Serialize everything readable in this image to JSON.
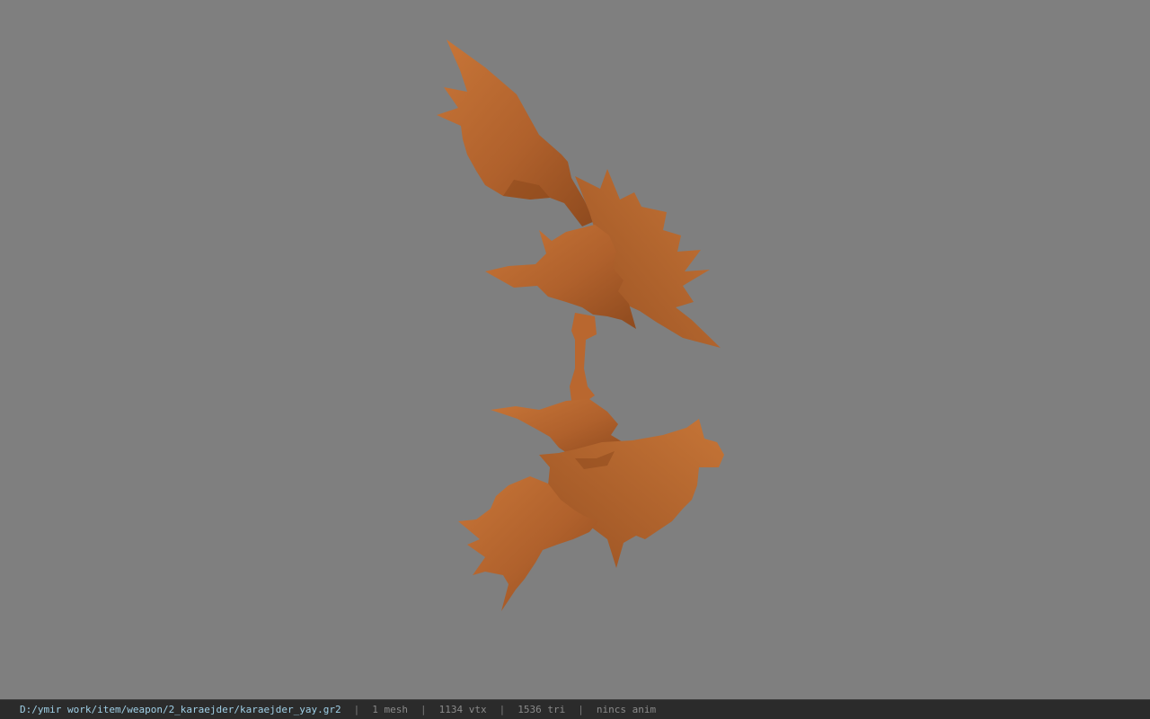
{
  "viewer": {
    "background_color": "#7f7f7f",
    "model_color": "#b5652f",
    "model_name": "karaejder_yay"
  },
  "status": {
    "file_path": "D:/ymir work/item/weapon/2_karaejder/karaejder_yay.gr2",
    "separator": "|",
    "mesh_count": "1 mesh",
    "vertex_count": "1134 vtx",
    "triangle_count": "1536 tri",
    "anim_status": "nincs anim"
  }
}
